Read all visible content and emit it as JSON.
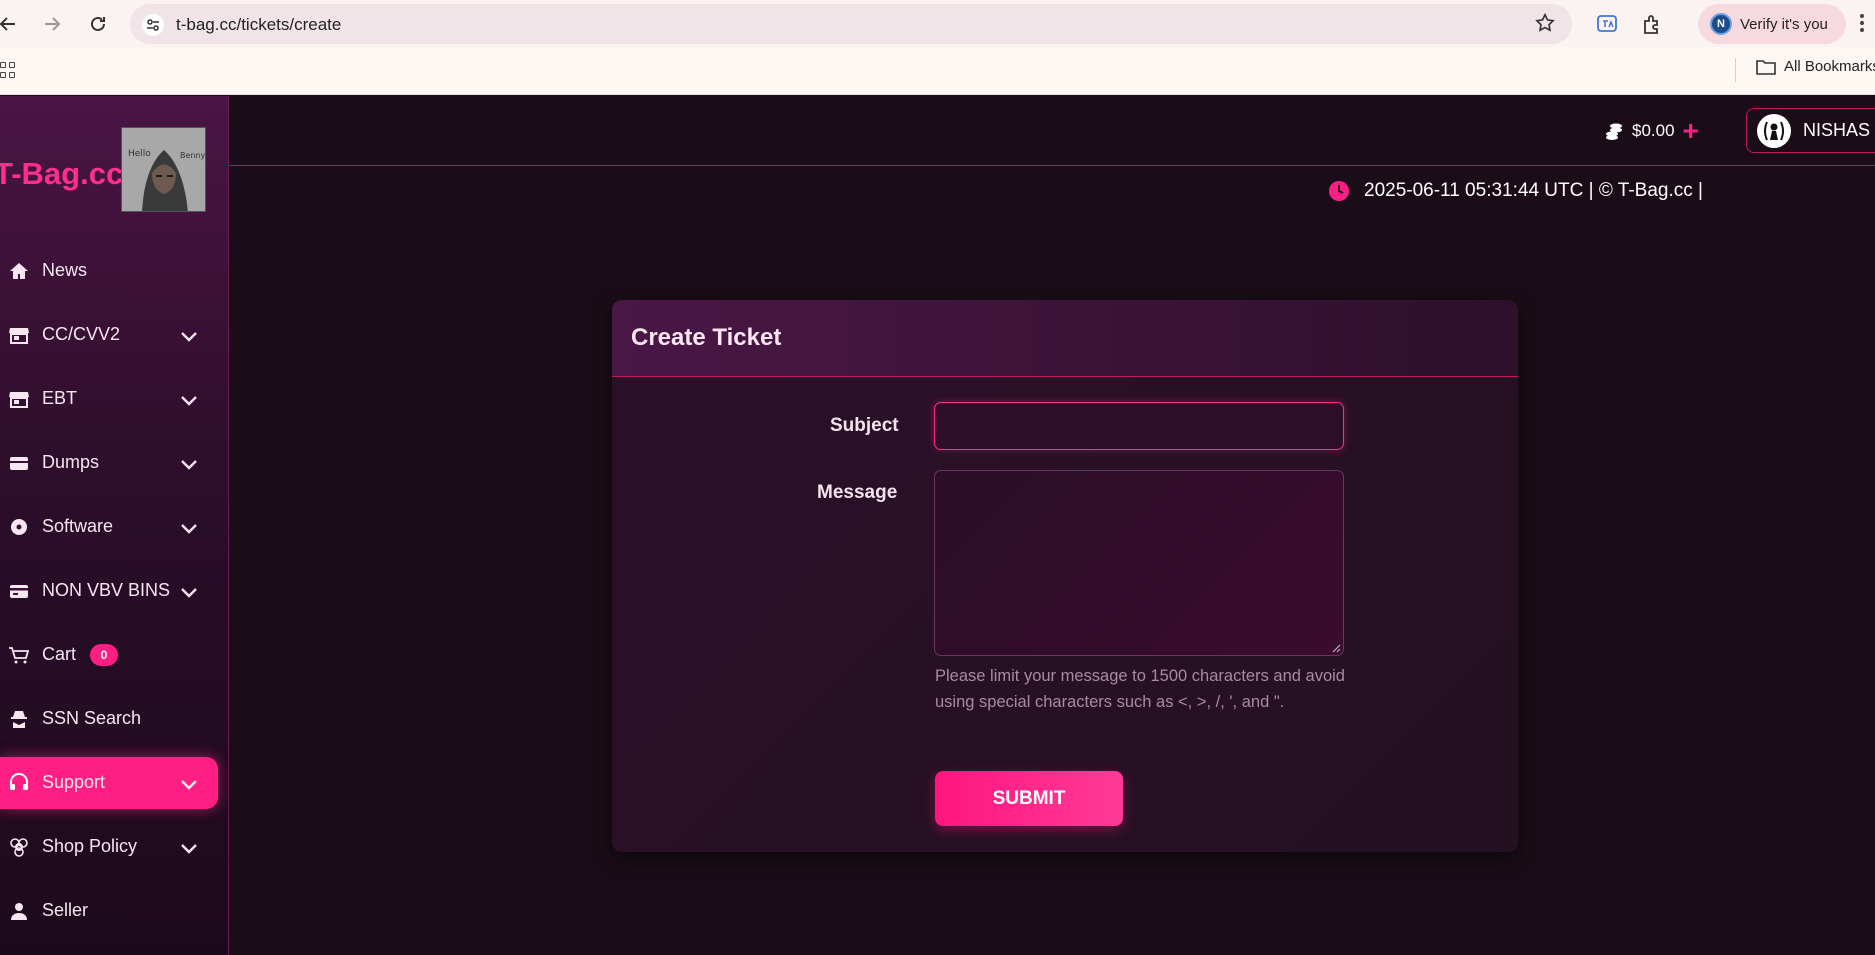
{
  "browser": {
    "url": "t-bag.cc/tickets/create",
    "verify_label": "Verify it's you",
    "verify_avatar_letter": "N",
    "bookmarks_label": "All Bookmarks"
  },
  "sidebar": {
    "brand": "T-Bag.cc",
    "items": [
      {
        "label": "News",
        "icon": "home-icon",
        "has_chevron": false
      },
      {
        "label": "CC/CVV2",
        "icon": "store-icon",
        "has_chevron": true
      },
      {
        "label": "EBT",
        "icon": "store-icon",
        "has_chevron": true
      },
      {
        "label": "Dumps",
        "icon": "card-icon",
        "has_chevron": true
      },
      {
        "label": "Software",
        "icon": "disc-icon",
        "has_chevron": true
      },
      {
        "label": "NON VBV BINS",
        "icon": "credit-card-icon",
        "has_chevron": true
      },
      {
        "label": "Cart",
        "icon": "cart-icon",
        "has_chevron": false,
        "badge": "0"
      },
      {
        "label": "SSN Search",
        "icon": "spy-icon",
        "has_chevron": false
      },
      {
        "label": "Support",
        "icon": "headset-icon",
        "has_chevron": true,
        "active": true
      },
      {
        "label": "Shop Policy",
        "icon": "biohazard-icon",
        "has_chevron": true
      },
      {
        "label": "Seller",
        "icon": "user-icon",
        "has_chevron": false
      }
    ]
  },
  "topbar": {
    "balance": "$0.00",
    "username": "NISHAS"
  },
  "status": {
    "timestamp": "2025-06-11 05:31:44 UTC | © T-Bag.cc |"
  },
  "form": {
    "title": "Create Ticket",
    "subject_label": "Subject",
    "subject_value": "",
    "message_label": "Message",
    "message_value": "",
    "help_text": "Please limit your message to 1500 characters and avoid using special characters such as <, >, /, ', and \".",
    "submit_label": "SUBMIT"
  },
  "colors": {
    "accent": "#ff1f84",
    "background": "#1a0d17",
    "sidebar_top": "#4a1545"
  }
}
